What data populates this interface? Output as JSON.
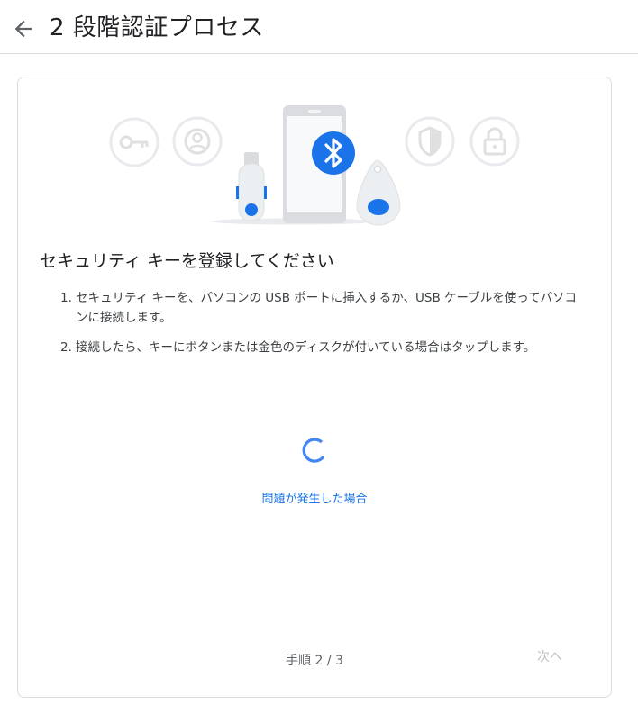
{
  "header": {
    "title": "2 段階認証プロセス"
  },
  "card": {
    "heading": "セキュリティ キーを登録してください",
    "steps": [
      {
        "number": "1.",
        "text": "セキュリティ キーを、パソコンの USB ポートに挿入するか、USB ケーブルを使ってパソコンに接続します。"
      },
      {
        "number": "2.",
        "text": "接続したら、キーにボタンまたは金色のディスクが付いている場合はタップします。"
      }
    ],
    "help_link": "問題が発生した場合",
    "footer": {
      "step_counter": "手順 2 / 3",
      "next_label": "次へ"
    }
  },
  "icons": {
    "back": "arrow-left-icon",
    "bluetooth": "bluetooth-icon",
    "key": "key-icon",
    "account": "account-icon",
    "shield": "shield-icon",
    "lock": "lock-icon",
    "usb_key": "usb-key-icon",
    "phone": "phone-icon",
    "fob": "key-fob-icon",
    "spinner": "loading-spinner-icon"
  },
  "colors": {
    "accent": "#1a73e8",
    "text": "#202124",
    "muted": "#5f6368",
    "disabled": "#bdc1c6",
    "border": "#dadce0"
  }
}
